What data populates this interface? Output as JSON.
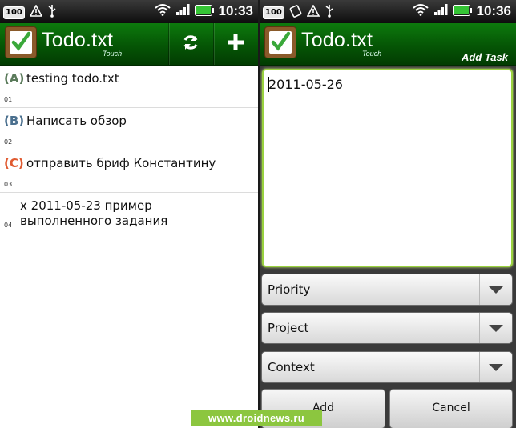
{
  "status_left": {
    "clock": "10:33",
    "battery_badge": "100"
  },
  "status_right": {
    "clock": "10:36",
    "battery_badge": "100"
  },
  "app": {
    "title": "Todo.txt",
    "subtitle": "Touch"
  },
  "list_screen": {
    "tasks": [
      {
        "priority": "(A)",
        "priority_color": "#5a7a5a",
        "text": "testing todo.txt",
        "number": "01"
      },
      {
        "priority": "(B)",
        "priority_color": "#4a6f8e",
        "text": "Написать обзор",
        "number": "02"
      },
      {
        "priority": "(C)",
        "priority_color": "#e05a30",
        "text": "отправить бриф Константину",
        "number": "03"
      },
      {
        "priority": "",
        "priority_color": "#000000",
        "text": "x 2011-05-23 пример выполненного задания",
        "number": "04"
      }
    ]
  },
  "add_screen": {
    "header_label": "Add Task",
    "task_input_value": "2011-05-26",
    "priority_spinner": "Priority",
    "project_spinner": "Project",
    "context_spinner": "Context",
    "add_button": "Add",
    "cancel_button": "Cancel"
  },
  "watermark": "www.droidnews.ru",
  "colors": {
    "header_green": "#055505",
    "focus_green": "#9ad240",
    "watermark_green": "#8cc63f"
  },
  "icons": [
    "battery-percent-icon",
    "warning-icon",
    "usb-icon",
    "rotate-icon",
    "wifi-icon",
    "signal-icon",
    "battery-icon",
    "refresh-icon",
    "plus-icon",
    "checklist-icon",
    "dropdown-arrow-icon"
  ]
}
